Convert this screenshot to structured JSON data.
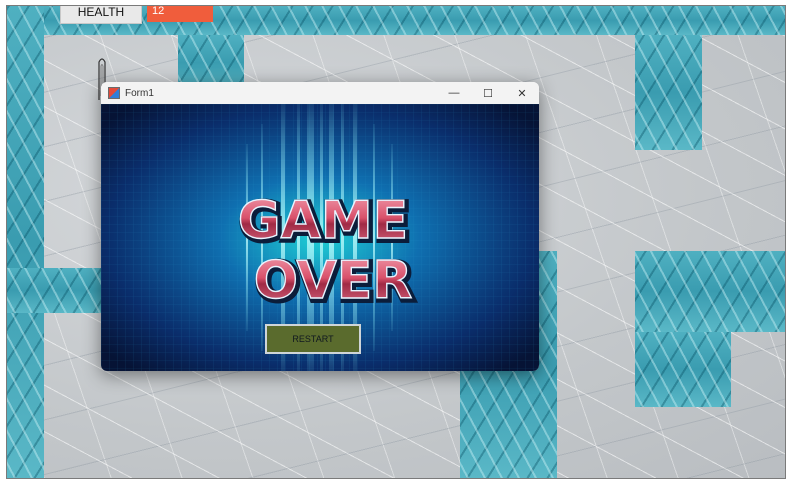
{
  "hud": {
    "health_label": "HEALTH",
    "health_value": "12"
  },
  "dialog": {
    "title": "Form1",
    "minimize_glyph": "—",
    "maximize_glyph": "☐",
    "close_glyph": "✕",
    "headline_line1": "GAME",
    "headline_line2": "OVER",
    "restart_label": "RESTART"
  },
  "colors": {
    "health_bar": "#f05d3c",
    "wall_water": "#3a9cb0",
    "floor_ice": "#c3c7ca",
    "restart_button": "#5a6b2d",
    "headline_fill": "#d9506a"
  },
  "icons": {
    "form_icon": "app-icon",
    "player": "player-sprite"
  }
}
